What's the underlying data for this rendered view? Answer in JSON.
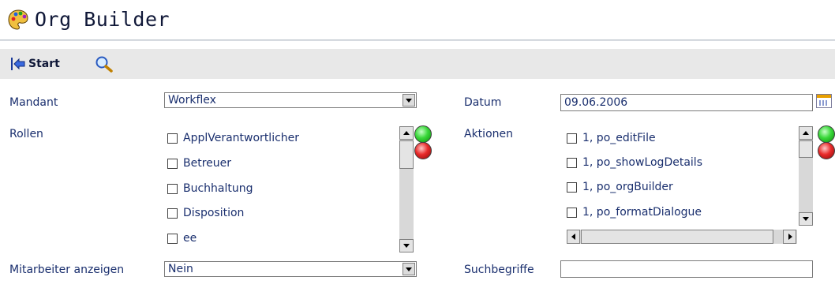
{
  "header": {
    "title": "Org Builder",
    "icon": "palette-icon"
  },
  "toolbar": {
    "start_label": "Start",
    "start_icon": "start-arrow-icon",
    "search_icon": "magnifier-icon"
  },
  "form": {
    "mandant": {
      "label": "Mandant",
      "value": "Workflex"
    },
    "rollen": {
      "label": "Rollen",
      "items": [
        "ApplVerantwortlicher",
        "Betreuer",
        "Buchhaltung",
        "Disposition",
        "ee"
      ]
    },
    "mitarbeiter": {
      "label": "Mitarbeiter anzeigen",
      "value": "Nein"
    },
    "datum": {
      "label": "Datum",
      "value": "09.06.2006"
    },
    "aktionen": {
      "label": "Aktionen",
      "items": [
        "1, po_editFile",
        "1, po_showLogDetails",
        "1, po_orgBuilder",
        "1, po_formatDialogue"
      ]
    },
    "suchbegriffe": {
      "label": "Suchbegriffe",
      "value": ""
    }
  },
  "colors": {
    "text": "#1a2f6e",
    "toolbar_bg": "#e8e8e8",
    "light_green": "#3ad83a",
    "light_red": "#e82a2a"
  }
}
